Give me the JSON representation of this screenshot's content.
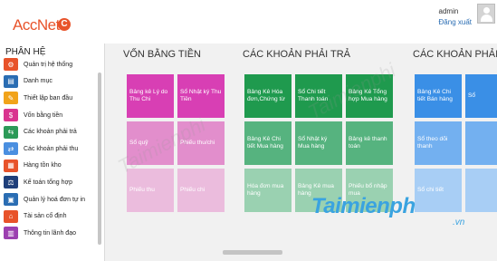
{
  "app": {
    "logo_text": "AccNet",
    "logo_mark": "C"
  },
  "header": {
    "user_name": "admin",
    "logout_label": "Đăng xuất"
  },
  "sidebar": {
    "title": "PHÂN HỆ",
    "items": [
      {
        "label": "Quản trị hệ thống",
        "icon": "system-admin-icon",
        "color": "#e8532a"
      },
      {
        "label": "Danh mục",
        "icon": "catalog-icon",
        "color": "#2a6db3"
      },
      {
        "label": "Thiết lập ban đầu",
        "icon": "setup-icon",
        "color": "#f1a31a"
      },
      {
        "label": "Vốn bằng tiền",
        "icon": "cash-icon",
        "color": "#d9358f"
      },
      {
        "label": "Các khoản phải trả",
        "icon": "payables-icon",
        "color": "#2c9a58"
      },
      {
        "label": "Các khoản phải thu",
        "icon": "receivables-icon",
        "color": "#4a8fe0"
      },
      {
        "label": "Hàng tồn kho",
        "icon": "inventory-icon",
        "color": "#e8532a"
      },
      {
        "label": "Kế toán tổng hợp",
        "icon": "general-ledger-icon",
        "color": "#1f3f7a"
      },
      {
        "label": "Quản lý hoá đơn tự in",
        "icon": "invoice-icon",
        "color": "#2a6db3"
      },
      {
        "label": "Tài sản cố định",
        "icon": "fixed-assets-icon",
        "color": "#e8532a"
      },
      {
        "label": "Thông tin lãnh đạo",
        "icon": "leadership-icon",
        "color": "#9c3fb0"
      }
    ]
  },
  "groups": [
    {
      "title": "VỐN BẰNG TIỀN",
      "tiles": [
        {
          "label": "Bảng kê Lý do Thu Chi",
          "color": "#d83fb4"
        },
        {
          "label": "Sổ Nhật ký Thu Tiền",
          "color": "#d83fb4"
        },
        {
          "label": "Sổ quỹ",
          "color": "#e28ecc"
        },
        {
          "label": "Phiếu thu/chi",
          "color": "#e28ecc"
        },
        {
          "label": "Phiếu thu",
          "color": "#ebbcdd"
        },
        {
          "label": "Phiếu chi",
          "color": "#ebbcdd"
        }
      ]
    },
    {
      "title": "CÁC KHOẢN PHẢI TRẢ",
      "tiles": [
        {
          "label": "Bảng Kê Hóa đơn,Chứng từ",
          "color": "#1f9a4e"
        },
        {
          "label": "Sổ Chi tiết Thanh toán",
          "color": "#1f9a4e"
        },
        {
          "label": "Bảng Kê Tổng hợp Mua hàng",
          "color": "#1f9a4e"
        },
        {
          "label": "Bảng Kê Chi tiết Mua hàng",
          "color": "#56b37f"
        },
        {
          "label": "Sổ Nhật ký Mua hàng",
          "color": "#56b37f"
        },
        {
          "label": "Bảng kê thanh toán",
          "color": "#56b37f"
        },
        {
          "label": "Hóa đơn mua hàng",
          "color": "#9ad1b1"
        },
        {
          "label": "Bảng Kê mua hàng",
          "color": "#9ad1b1"
        },
        {
          "label": "Phiếu bổ nhập mua",
          "color": "#9ad1b1"
        }
      ]
    },
    {
      "title": "CÁC KHOẢN PHẢI THU",
      "tiles": [
        {
          "label": "Bảng Kê Chi tiết Bán hàng",
          "color": "#3a8fe6"
        },
        {
          "label": "Sổ",
          "color": "#3a8fe6"
        },
        {
          "label": "Sổ theo dõi thanh",
          "color": "#73b0f0"
        },
        {
          "label": "",
          "color": "#73b0f0"
        },
        {
          "label": "Sổ chi tiết",
          "color": "#a8cef5"
        },
        {
          "label": "",
          "color": "#a8cef5"
        }
      ]
    }
  ],
  "watermark": {
    "brand": "Taimienph",
    "suffix": ".vn",
    "faint": "Taimienphi"
  }
}
